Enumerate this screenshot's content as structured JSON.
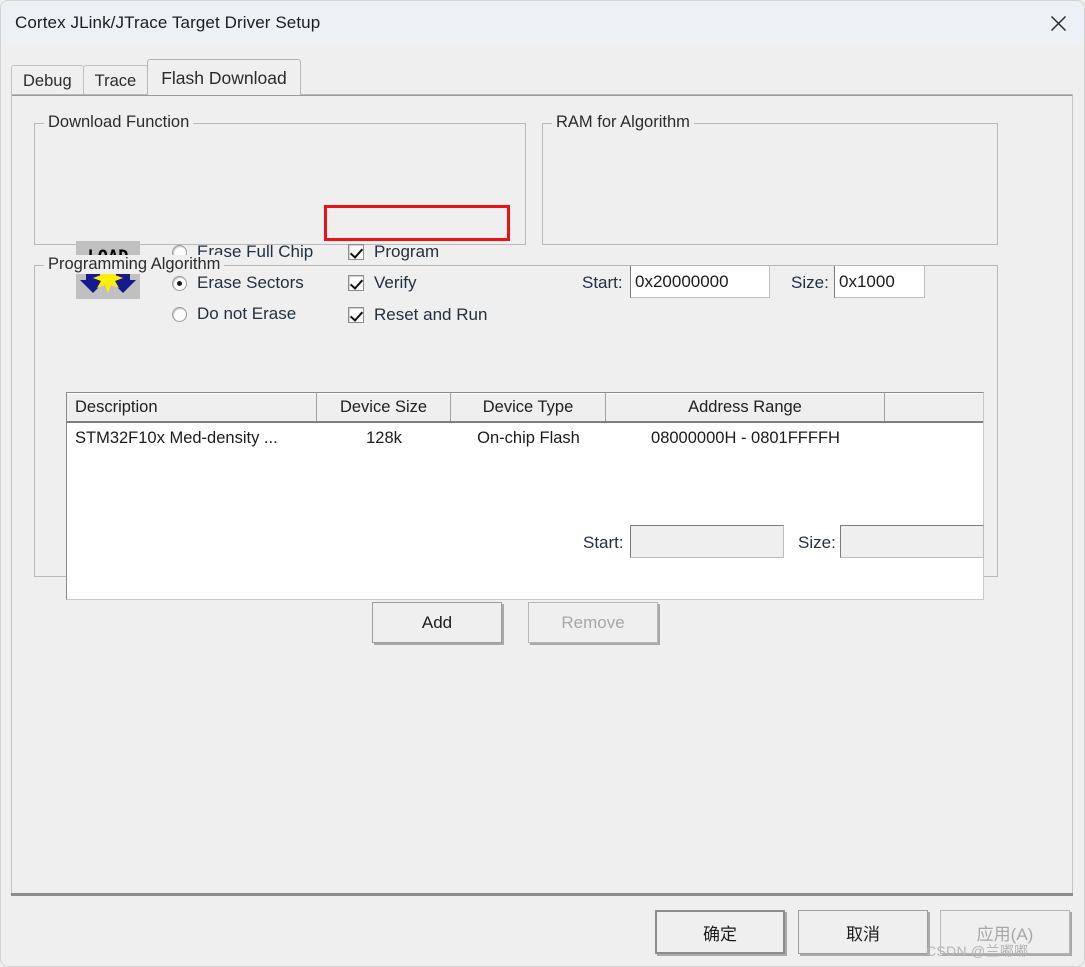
{
  "window": {
    "title": "Cortex JLink/JTrace Target Driver Setup",
    "close_icon": "close-icon"
  },
  "tabs": [
    {
      "label": "Debug",
      "active": false
    },
    {
      "label": "Trace",
      "active": false
    },
    {
      "label": "Flash Download",
      "active": true
    }
  ],
  "download_function": {
    "legend": "Download Function",
    "icon": "load-icon",
    "radios": [
      {
        "label": "Erase Full Chip",
        "checked": false
      },
      {
        "label": "Erase Sectors",
        "checked": true
      },
      {
        "label": "Do not Erase",
        "checked": false
      }
    ],
    "checkboxes": [
      {
        "label": "Program",
        "checked": true
      },
      {
        "label": "Verify",
        "checked": true
      },
      {
        "label": "Reset and Run",
        "checked": true,
        "highlighted": true
      }
    ]
  },
  "ram_for_algorithm": {
    "legend": "RAM for Algorithm",
    "start_label": "Start:",
    "start_value": "0x20000000",
    "size_label": "Size:",
    "size_value": "0x1000"
  },
  "programming_algorithm": {
    "legend": "Programming Algorithm",
    "columns": [
      "Description",
      "Device Size",
      "Device Type",
      "Address Range",
      ""
    ],
    "rows": [
      {
        "description": "STM32F10x Med-density ...",
        "device_size": "128k",
        "device_type": "On-chip Flash",
        "address_range": "08000000H - 0801FFFFH",
        "extra": ""
      }
    ],
    "start_label": "Start:",
    "start_value": "",
    "size_label": "Size:",
    "size_value": "",
    "add_label": "Add",
    "remove_label": "Remove",
    "remove_disabled": true
  },
  "dialog_buttons": {
    "ok": "确定",
    "cancel": "取消",
    "apply": "应用(A)",
    "apply_disabled": true
  },
  "watermark": "CSDN @兰嘟嘟",
  "colors": {
    "annotation": "#e81313",
    "titlebar": "#edf1f6",
    "body": "#efefef",
    "label_text": "#22303f"
  }
}
